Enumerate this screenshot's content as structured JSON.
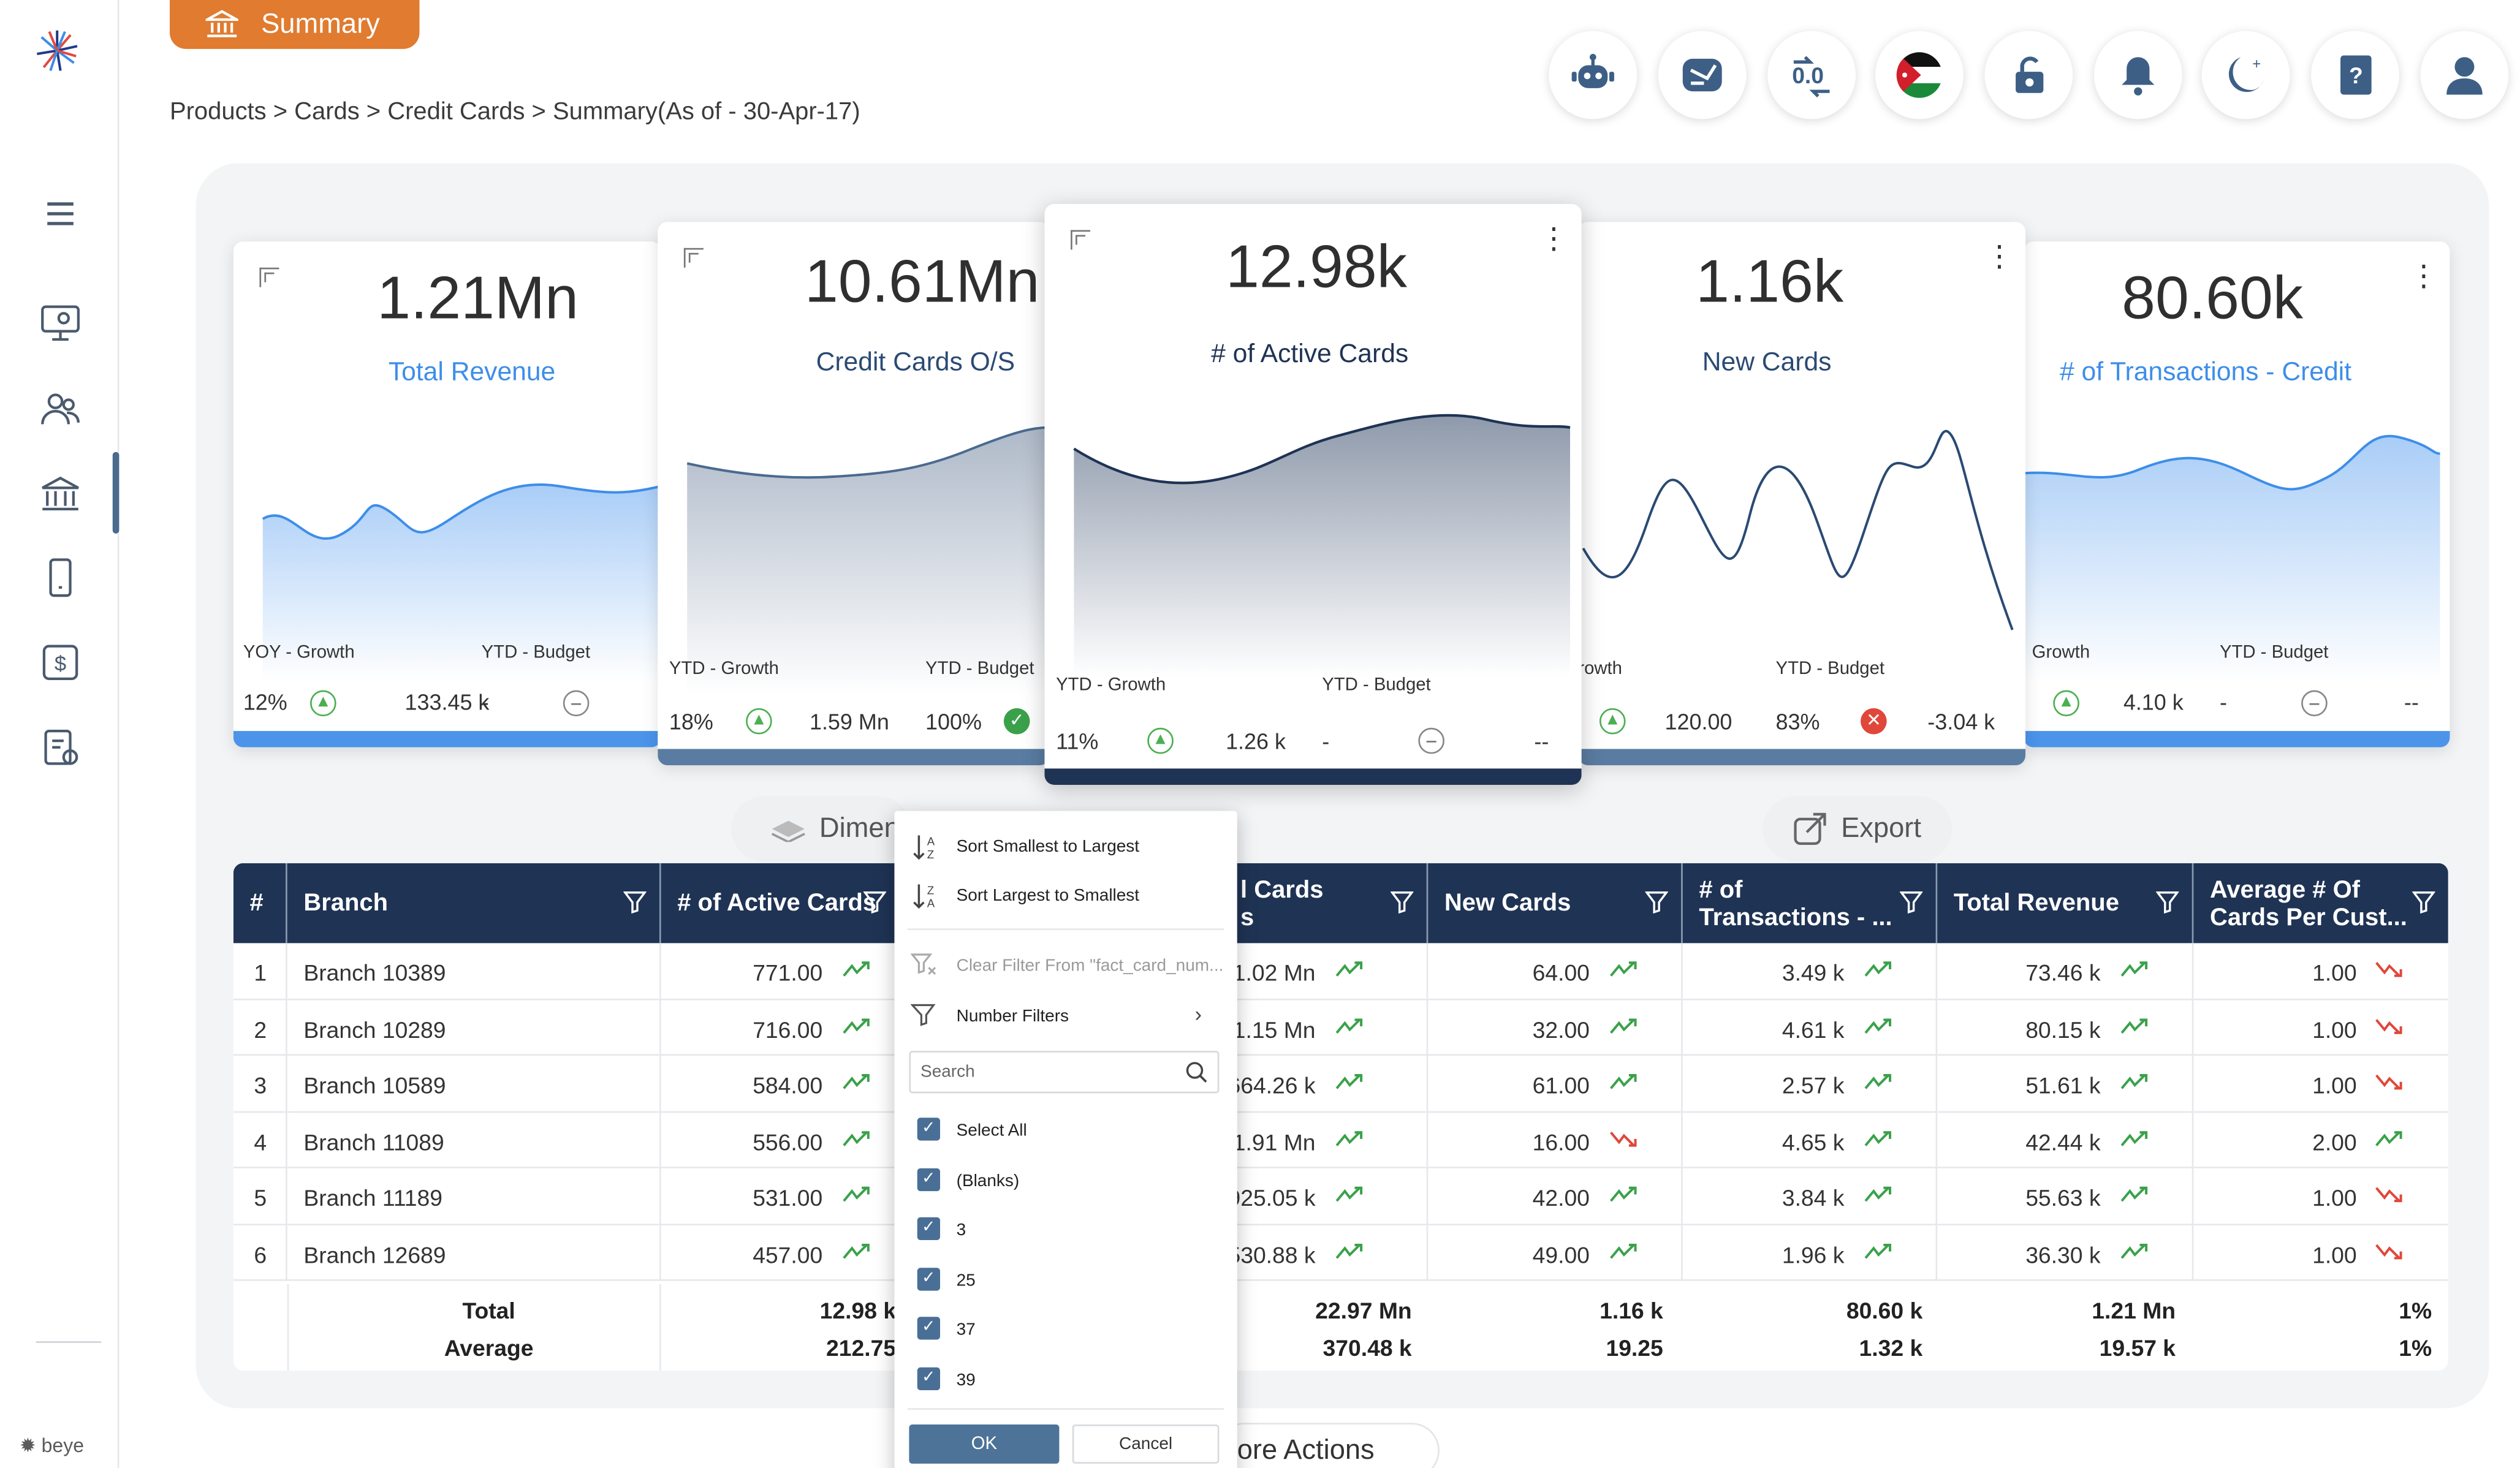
{
  "header": {
    "tab_label": "Summary",
    "breadcrumb": "Products > Cards > Credit Cards > Summary(As of - 30-Apr-17)",
    "icons": [
      "robot-icon",
      "message-icon",
      "currency-convert-icon",
      "jordan-flag-icon",
      "lock-refresh-icon",
      "bell-icon",
      "moon-icon",
      "help-book-icon",
      "user-icon"
    ]
  },
  "sidebar": {
    "brand": "beye",
    "items": [
      "menu-icon",
      "dashboard-monitor-icon",
      "customers-icon",
      "bank-icon",
      "mobile-icon",
      "dollar-icon",
      "report-settings-icon"
    ]
  },
  "kpis": [
    {
      "value": "1.21",
      "unit": "Mn",
      "label": "Total Revenue",
      "sub1": "YOY - Growth",
      "sub2": "YTD - Budget",
      "n1": "12%",
      "n2": "133.45 k",
      "n3": "-"
    },
    {
      "value": "10.61",
      "unit": "Mn",
      "label": "Credit Cards O/S",
      "sub1": "YTD - Growth",
      "sub2": "YTD - Budget",
      "n1": "18%",
      "n2": "1.59 Mn",
      "n3": "100%"
    },
    {
      "value": "12.98k",
      "unit": "",
      "label": "# of Active Cards",
      "sub1": "YTD - Growth",
      "sub2": "YTD - Budget",
      "n1": "11%",
      "n2": "1.26 k",
      "n3": "-",
      "n4": "--"
    },
    {
      "value": "1.16k",
      "unit": "",
      "label": "New Cards",
      "sub1": "rowth",
      "sub2": "YTD - Budget",
      "n2": "120.00",
      "n3": "83%",
      "n4": "-3.04 k"
    },
    {
      "value": "80.60k",
      "unit": "",
      "label": "# of Transactions - Credit",
      "sub1": "Growth",
      "sub2": "YTD - Budget",
      "n2": "4.10 k",
      "n3": "-",
      "n4": "--"
    }
  ],
  "toolbar": {
    "dimension": "Dimen",
    "export": "Export",
    "more": "ore Actions"
  },
  "table": {
    "headers": [
      "#",
      "Branch",
      "# of Active Cards",
      "l Cards\ns",
      "New Cards",
      "# of\nTransactions - ...",
      "Total Revenue",
      "Average # Of\nCards Per Cust..."
    ],
    "rows": [
      {
        "n": "1",
        "branch": "Branch 10389",
        "active": "771.00",
        "os": "1.02 Mn",
        "newc": "64.00",
        "tx": "3.49 k",
        "rev": "73.46 k",
        "avg": "1.00"
      },
      {
        "n": "2",
        "branch": "Branch 10289",
        "active": "716.00",
        "os": "1.15 Mn",
        "newc": "32.00",
        "tx": "4.61 k",
        "rev": "80.15 k",
        "avg": "1.00"
      },
      {
        "n": "3",
        "branch": "Branch 10589",
        "active": "584.00",
        "os": "664.26 k",
        "newc": "61.00",
        "tx": "2.57 k",
        "rev": "51.61 k",
        "avg": "1.00"
      },
      {
        "n": "4",
        "branch": "Branch 11089",
        "active": "556.00",
        "os": "1.91 Mn",
        "newc": "16.00",
        "tx": "4.65 k",
        "rev": "42.44 k",
        "avg": "2.00"
      },
      {
        "n": "5",
        "branch": "Branch 11189",
        "active": "531.00",
        "os": "925.05 k",
        "newc": "42.00",
        "tx": "3.84 k",
        "rev": "55.63 k",
        "avg": "1.00"
      },
      {
        "n": "6",
        "branch": "Branch 12689",
        "active": "457.00",
        "os": "530.88 k",
        "newc": "49.00",
        "tx": "1.96 k",
        "rev": "36.30 k",
        "avg": "1.00"
      }
    ],
    "total": {
      "label": "Total",
      "active": "12.98 k",
      "os": "22.97 Mn",
      "newc": "1.16 k",
      "tx": "80.60 k",
      "rev": "1.21 Mn",
      "avg": "1%"
    },
    "average": {
      "label": "Average",
      "active": "212.75",
      "os": "370.48 k",
      "newc": "19.25",
      "tx": "1.32 k",
      "rev": "19.57 k",
      "avg": "1%"
    }
  },
  "filter_menu": {
    "sort_asc": "Sort Smallest to Largest",
    "sort_desc": "Sort Largest to Smallest",
    "clear": "Clear Filter From \"fact_card_num...",
    "number_filters": "Number Filters",
    "search_placeholder": "Search",
    "options": [
      "Select All",
      "(Blanks)",
      "3",
      "25",
      "37",
      "39"
    ],
    "ok": "OK",
    "cancel": "Cancel"
  },
  "colors": {
    "accent": "#e07b2f",
    "header": "#1f3354",
    "blue": "#3d8ee8",
    "up": "#3aa14a",
    "down": "#e0473a"
  }
}
